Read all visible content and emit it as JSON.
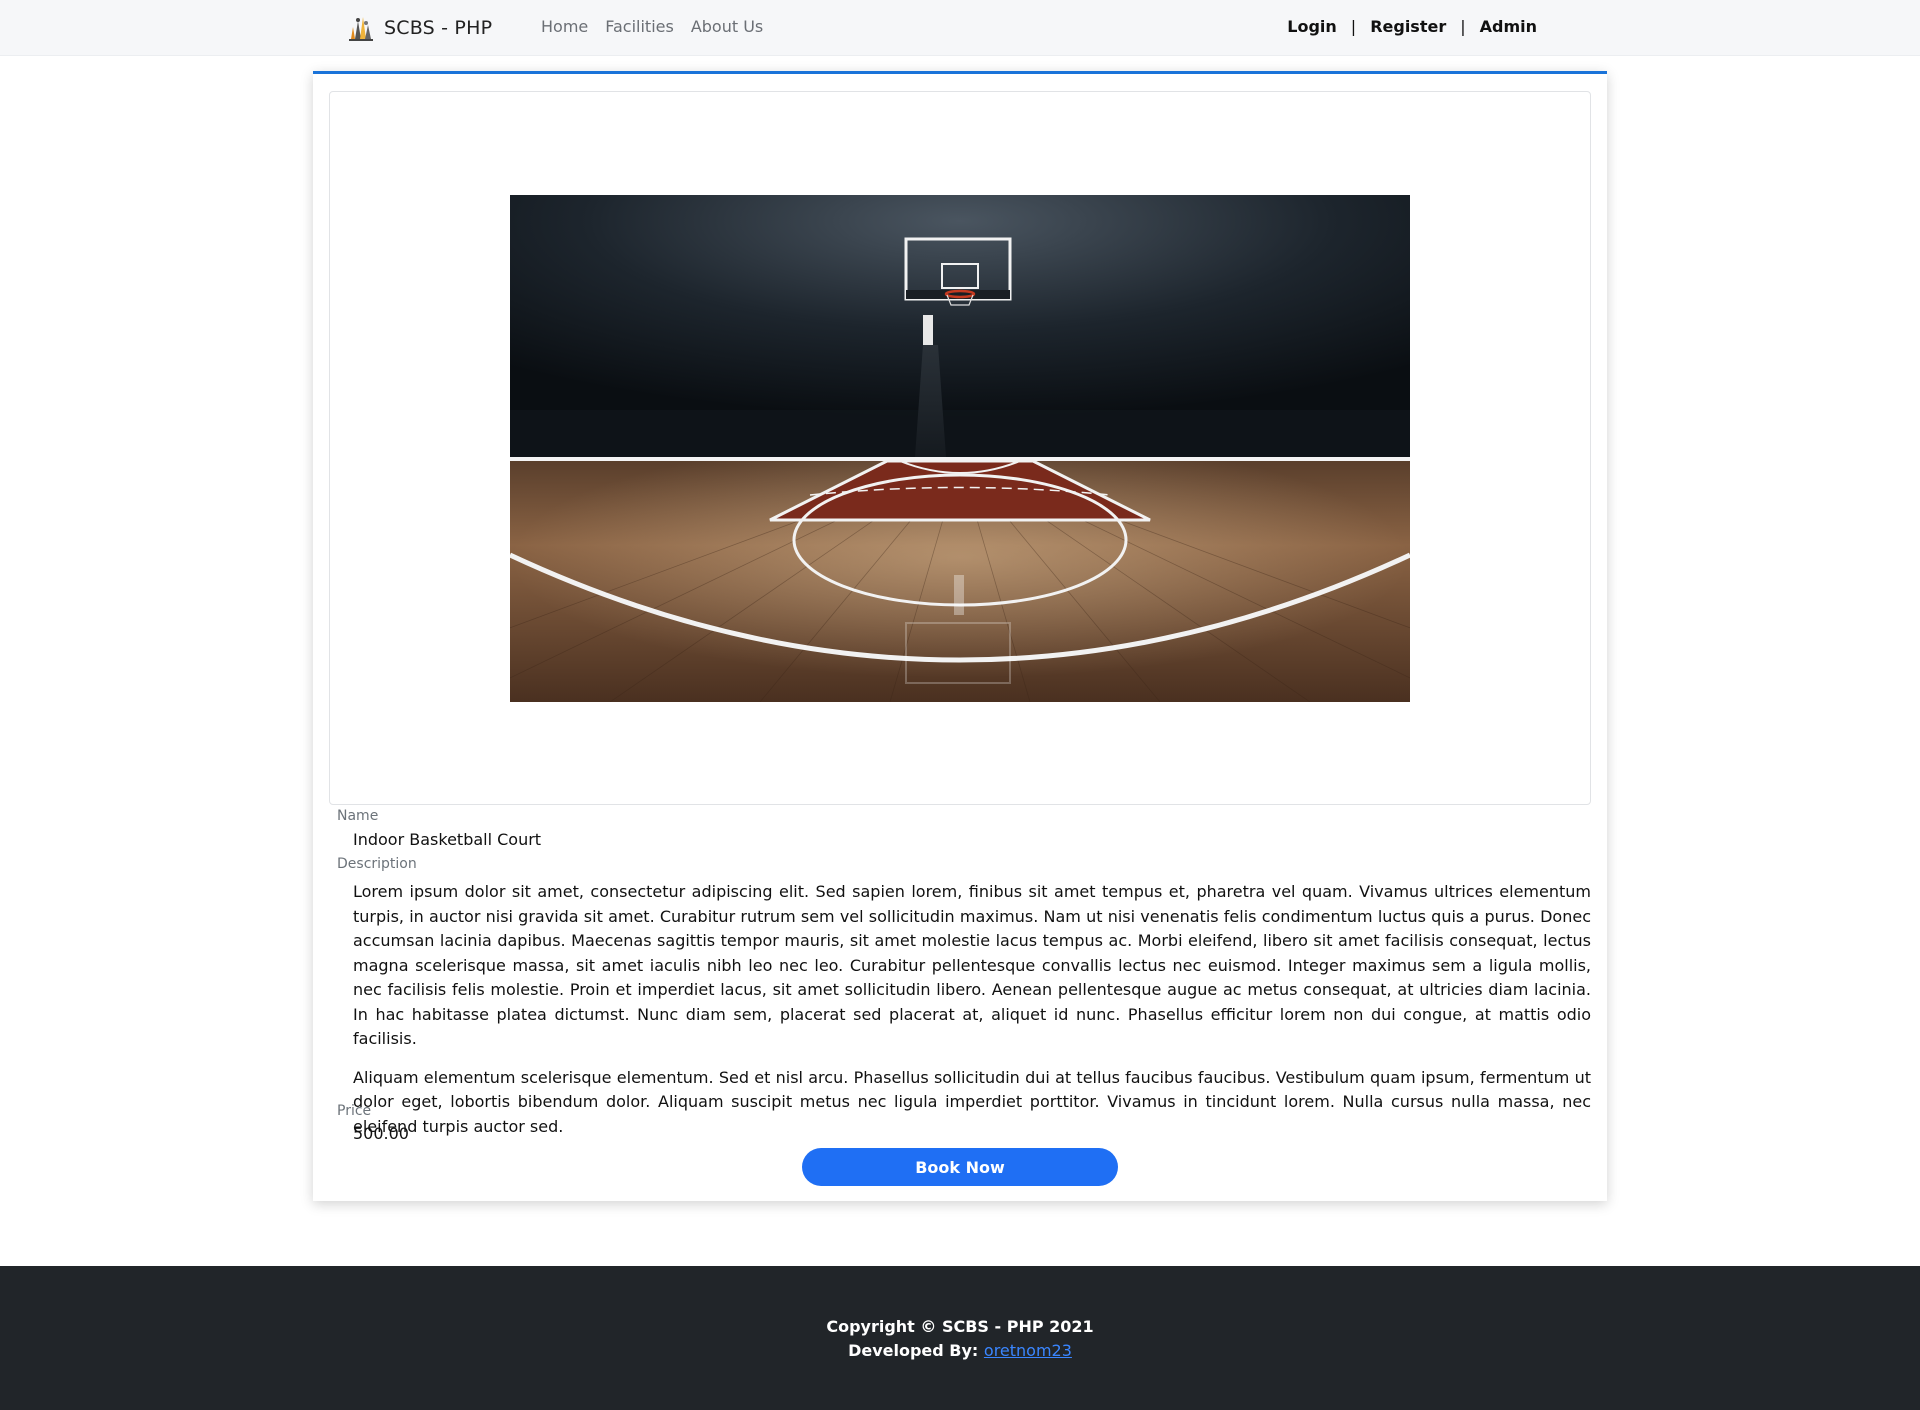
{
  "nav": {
    "brand": "SCBS - PHP",
    "links": [
      "Home",
      "Facilities",
      "About Us"
    ],
    "login": "Login",
    "register": "Register",
    "admin": "Admin",
    "separator": "|"
  },
  "facility": {
    "image_subject": "indoor-basketball-court",
    "name_label": "Name",
    "name": "Indoor Basketball Court",
    "description_label": "Description",
    "description": [
      "Lorem ipsum dolor sit amet, consectetur adipiscing elit. Sed sapien lorem, finibus sit amet tempus et, pharetra vel quam. Vivamus ultrices elementum turpis, in auctor nisi gravida sit amet. Curabitur rutrum sem vel sollicitudin maximus. Nam ut nisi venenatis felis condimentum luctus quis a purus. Donec accumsan lacinia dapibus. Maecenas sagittis tempor mauris, sit amet molestie lacus tempus ac. Morbi eleifend, libero sit amet facilisis consequat, lectus magna scelerisque massa, sit amet iaculis nibh leo nec leo. Curabitur pellentesque convallis lectus nec euismod. Integer maximus sem a ligula mollis, nec facilisis felis molestie. Proin et imperdiet lacus, sit amet sollicitudin libero. Aenean pellentesque augue ac metus consequat, at ultricies diam lacinia. In hac habitasse platea dictumst. Nunc diam sem, placerat sed placerat at, aliquet id nunc. Phasellus efficitur lorem non dui congue, at mattis odio facilisis.",
      "Aliquam elementum scelerisque elementum. Sed et nisl arcu. Phasellus sollicitudin dui at tellus faucibus faucibus. Vestibulum quam ipsum, fermentum ut dolor eget, lobortis bibendum dolor. Aliquam suscipit metus nec ligula imperdiet porttitor. Vivamus in tincidunt lorem. Nulla cursus nulla massa, nec eleifend turpis auctor sed."
    ],
    "price_label": "Price",
    "price": "500.00",
    "book_button": "Book Now"
  },
  "footer": {
    "copyright": "Copyright © SCBS - PHP 2021",
    "developed_by": "Developed By:",
    "developer": "oretnom23"
  },
  "colors": {
    "accent": "#1a73d9",
    "button": "#1f6ff4",
    "footer_bg": "#212529",
    "footer_link": "#3a86ff"
  }
}
